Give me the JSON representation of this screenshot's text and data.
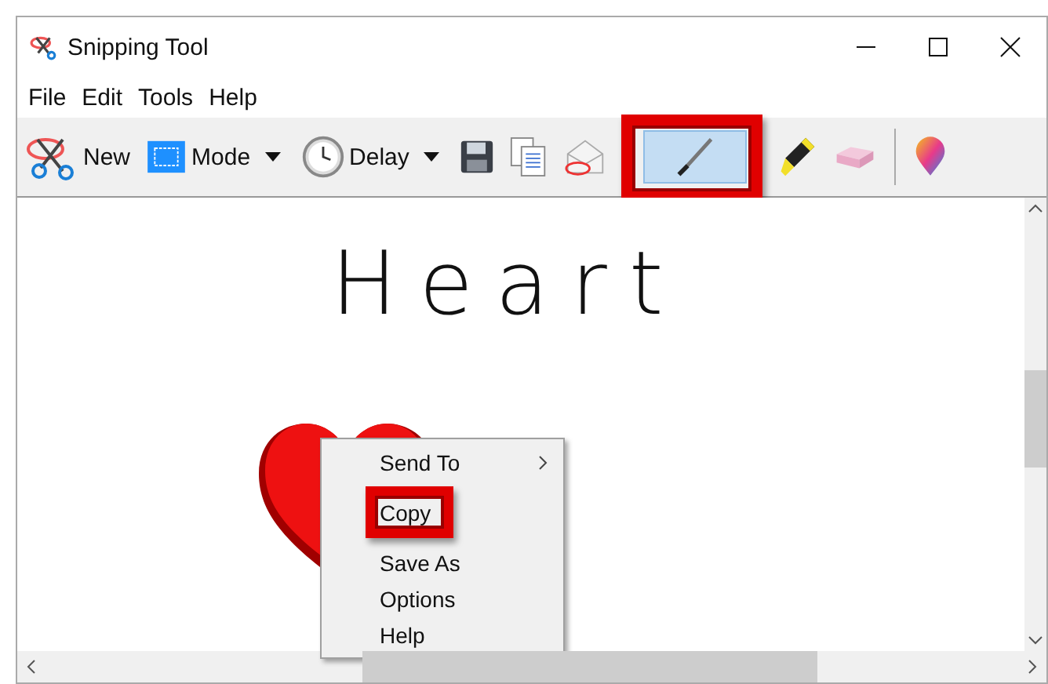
{
  "window": {
    "title": "Snipping Tool"
  },
  "menu_bar": [
    "File",
    "Edit",
    "Tools",
    "Help"
  ],
  "toolbar": [
    {
      "kind": "text",
      "label": "New",
      "dropdown": false,
      "selected": false
    },
    {
      "kind": "text",
      "label": "Mode",
      "dropdown": true,
      "selected": false
    },
    {
      "kind": "text",
      "label": "Delay",
      "dropdown": true,
      "selected": false
    },
    {
      "kind": "icon",
      "selected": false
    },
    {
      "kind": "icon",
      "selected": false
    },
    {
      "kind": "icon",
      "selected": false
    },
    {
      "kind": "icon",
      "selected": true,
      "annotated": true
    },
    {
      "kind": "icon",
      "selected": false
    },
    {
      "kind": "icon",
      "selected": false
    },
    {
      "kind": "icon",
      "selected": false
    }
  ],
  "canvas": {
    "ink_text": "Heart"
  },
  "context_menu": [
    {
      "label": "Send To",
      "submenu": true,
      "annotated": false
    },
    {
      "label": "Copy",
      "submenu": false,
      "annotated": true
    },
    {
      "label": "Save As",
      "submenu": false,
      "annotated": false
    },
    {
      "label": "Options",
      "submenu": false,
      "annotated": false
    },
    {
      "label": "Help",
      "submenu": false,
      "annotated": false
    }
  ]
}
